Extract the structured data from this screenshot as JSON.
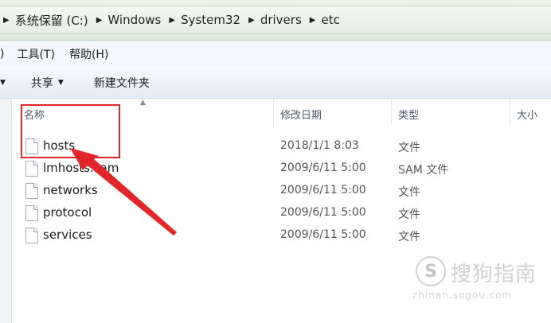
{
  "address": {
    "crumbs": [
      "系统保留 (C:)",
      "Windows",
      "System32",
      "drivers",
      "etc"
    ]
  },
  "menu": {
    "items": [
      "工具(T)",
      "帮助(H)"
    ],
    "cut_item": ")"
  },
  "toolbar": {
    "share_label": "共享",
    "new_folder_label": "新建文件夹"
  },
  "columns": {
    "name": "名称",
    "modified": "修改日期",
    "type": "类型",
    "size": "大小"
  },
  "files": [
    {
      "name": "hosts",
      "modified": "2018/1/1 8:03",
      "type": "文件"
    },
    {
      "name": "lmhosts.sam",
      "modified": "2009/6/11 5:00",
      "type": "SAM 文件"
    },
    {
      "name": "networks",
      "modified": "2009/6/11 5:00",
      "type": "文件"
    },
    {
      "name": "protocol",
      "modified": "2009/6/11 5:00",
      "type": "文件"
    },
    {
      "name": "services",
      "modified": "2009/6/11 5:00",
      "type": "文件"
    }
  ],
  "annotation": {
    "color": "#e3262a",
    "highlighted_file": "hosts"
  },
  "watermark": {
    "logo_glyph": "S",
    "text": "搜狗指南",
    "url": "zhinan.sogou.com"
  },
  "icons": {
    "breadcrumb_separator": "chevron-right-icon",
    "file": "file-icon",
    "dropdown": "caret-down-icon"
  }
}
